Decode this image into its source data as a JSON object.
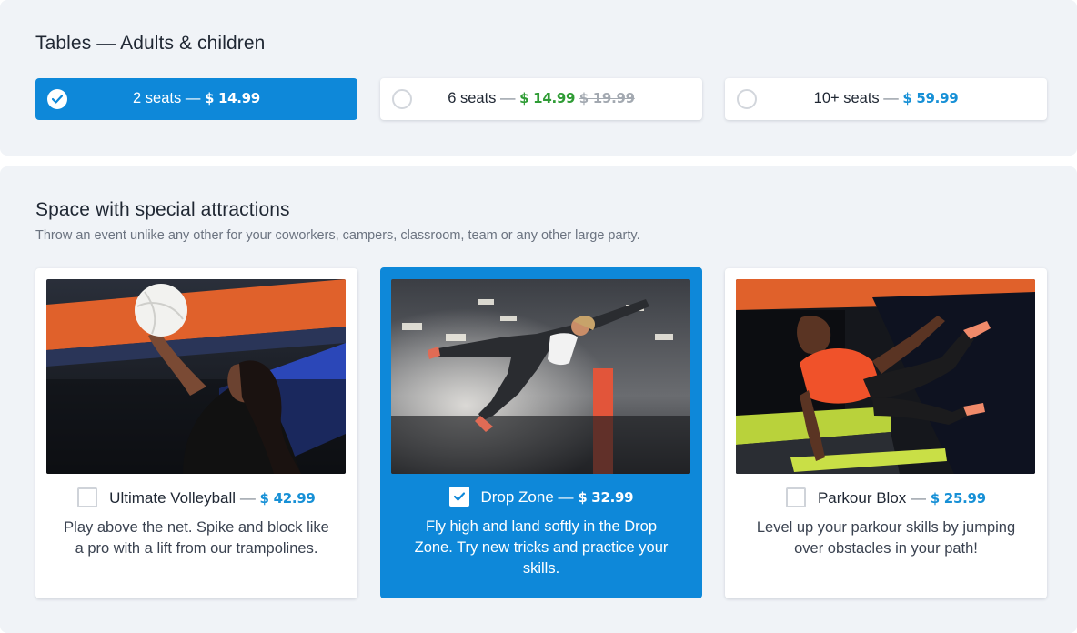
{
  "tables": {
    "heading": "Tables — Adults & children",
    "options": [
      {
        "name": "2 seats",
        "dash": "—",
        "price": "$ 14.99",
        "selected": true
      },
      {
        "name": "6 seats",
        "dash": "—",
        "price": "$ 14.99",
        "old_price": "$ 19.99",
        "selected": false
      },
      {
        "name": "10+ seats",
        "dash": "—",
        "price": "$ 59.99",
        "selected": false
      }
    ]
  },
  "attractions": {
    "heading": "Space with special attractions",
    "subtitle": "Throw an event unlike any other for your coworkers, campers, classroom, team or any other large party.",
    "cards": [
      {
        "title": "Ultimate Volleyball",
        "dash": "—",
        "price": "$ 42.99",
        "checked": false,
        "description": "Play above the net. Spike and block like a pro with a lift from our trampolines."
      },
      {
        "title": "Drop Zone",
        "dash": "—",
        "price": "$ 32.99",
        "checked": true,
        "description": "Fly high and land softly in the Drop Zone. Try new tricks and practice your skills."
      },
      {
        "title": "Parkour Blox",
        "dash": "—",
        "price": "$ 25.99",
        "checked": false,
        "description": "Level up your parkour skills by jumping over obstacles in your path!"
      }
    ]
  },
  "colors": {
    "accent": "#0e88d9",
    "price_blue": "#1790d6",
    "price_green": "#2f9c35",
    "panel_bg": "#f0f3f7"
  }
}
